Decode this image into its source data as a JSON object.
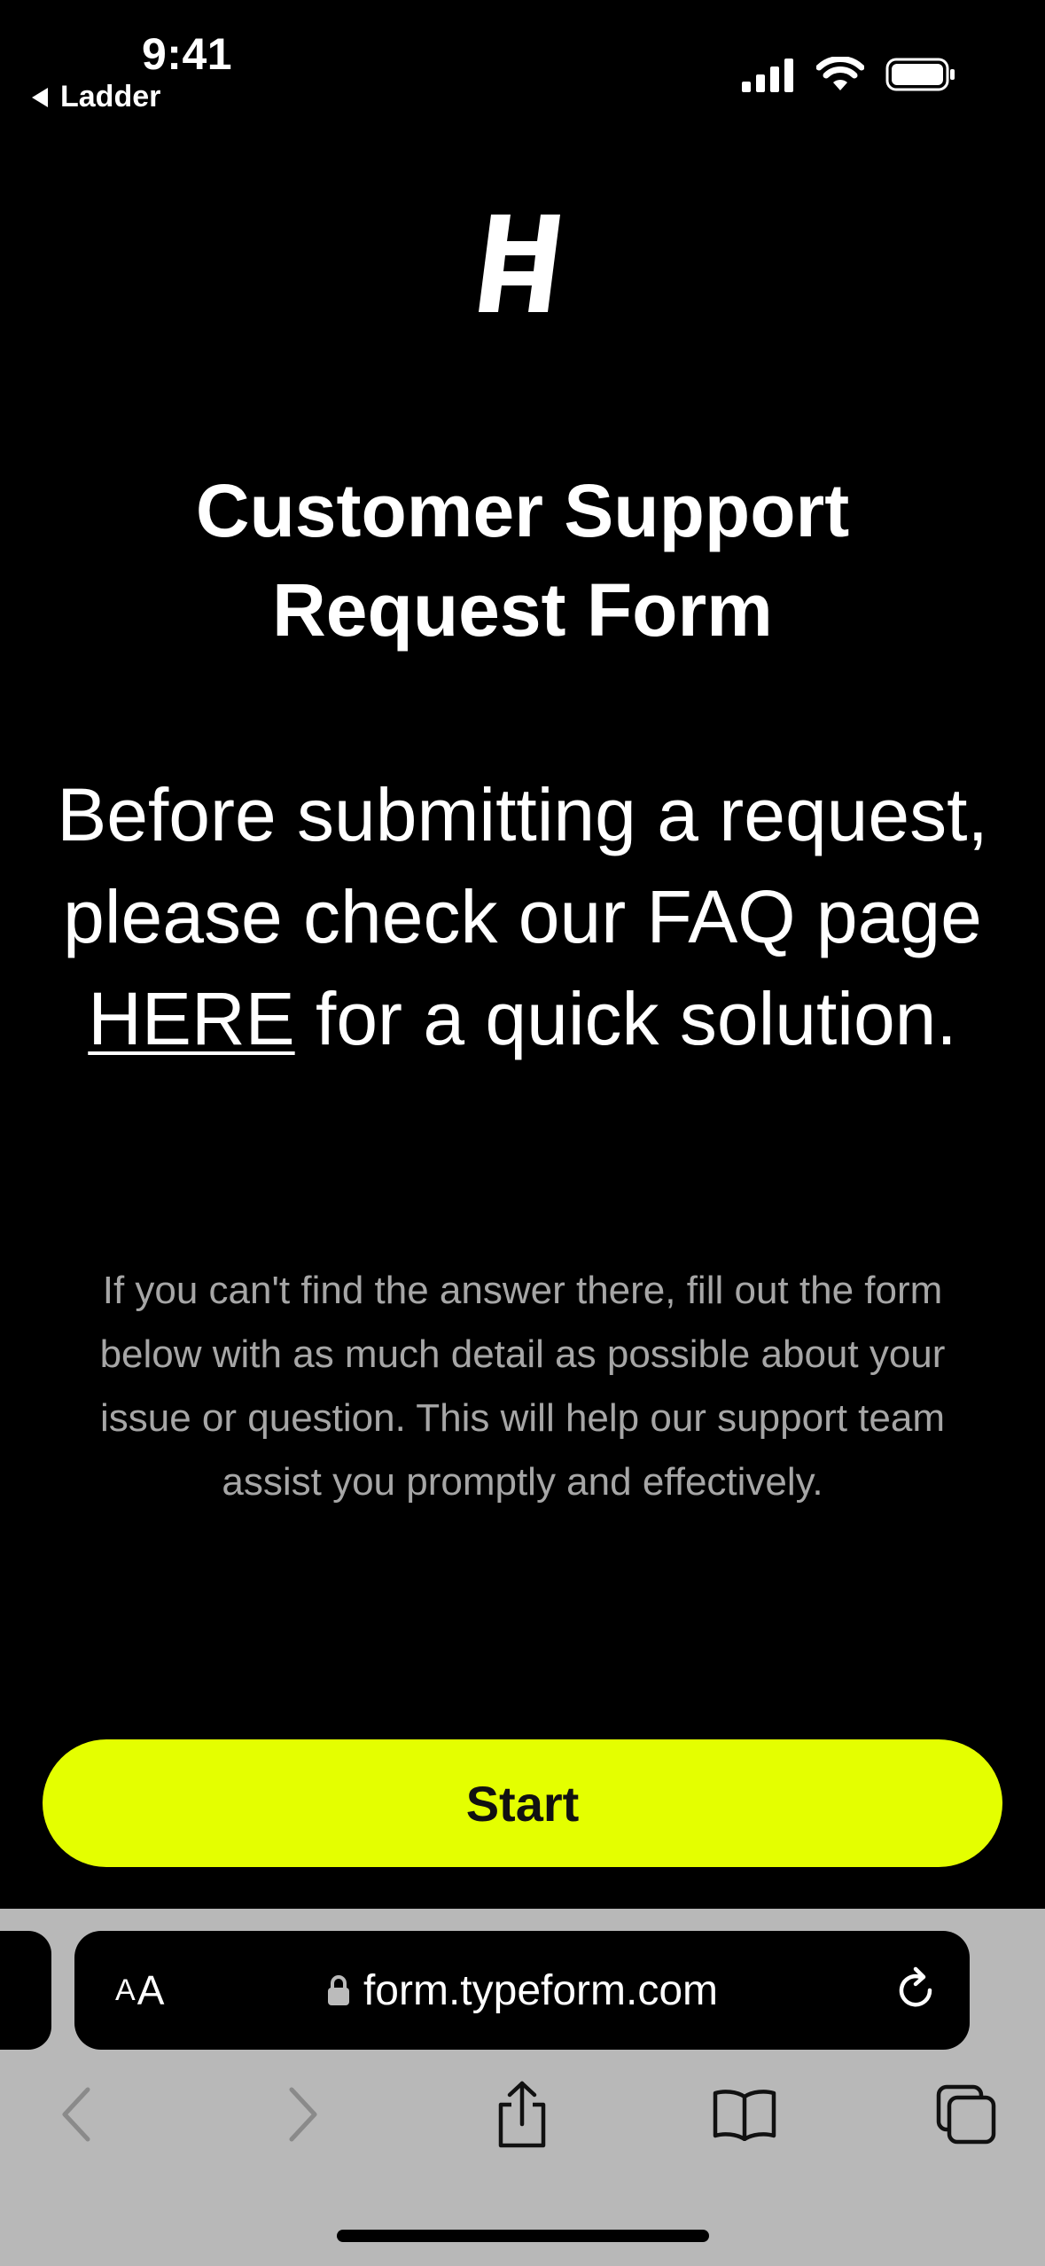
{
  "status_bar": {
    "time": "9:41",
    "back_app": "Ladder"
  },
  "form": {
    "title_line1": "Customer Support",
    "title_line2": "Request Form",
    "intro_part1": "Before submitting a request, please check our FAQ page ",
    "faq_link": "HERE",
    "intro_part2": " for a quick solution.",
    "body": "If you can't find the answer there, fill out the form below with as much detail as possible about your issue or question. This will help our support team assist you promptly and effectively.",
    "start_label": "Start"
  },
  "browser": {
    "text_size_small": "A",
    "text_size_large": "A",
    "url": "form.typeform.com"
  },
  "colors": {
    "background": "#000000",
    "accent": "#E4FF00",
    "body_text": "#A6A6A6",
    "chrome": "#B8B8B8"
  },
  "icons": {
    "status": [
      "signal-icon",
      "wifi-icon",
      "battery-icon"
    ],
    "toolbar": [
      "back-icon",
      "forward-icon",
      "share-icon",
      "bookmarks-icon",
      "tabs-icon"
    ]
  }
}
